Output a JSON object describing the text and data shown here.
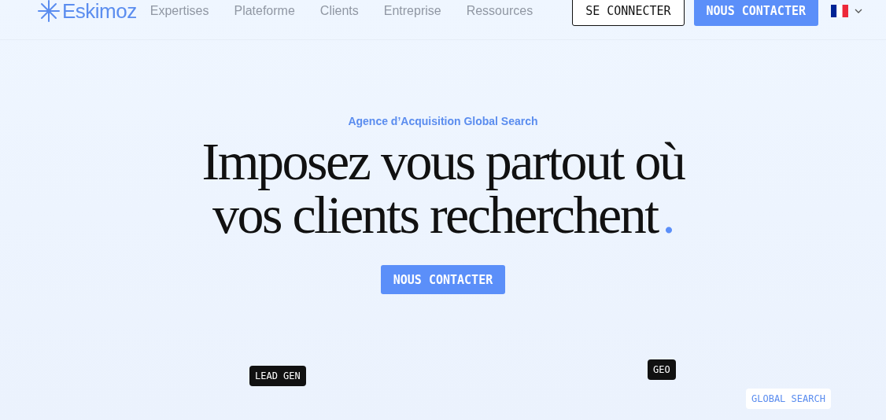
{
  "header": {
    "logo": "Eskimoz",
    "nav": [
      "Expertises",
      "Plateforme",
      "Clients",
      "Entreprise",
      "Ressources"
    ],
    "login_button": "SE CONNECTER",
    "contact_button": "NOUS CONTACTER"
  },
  "hero": {
    "eyebrow": "Agence d’Acquisition Global Search",
    "headline_lines": [
      "Imposez vous partout où",
      "vos clients recherchent"
    ],
    "headline_end": ".",
    "cta": "NOUS CONTACTER"
  },
  "tags": [
    {
      "label": "LEAD GEN",
      "kind": "dark"
    },
    {
      "label": "GEO",
      "kind": "dark"
    },
    {
      "label": "GLOBAL SEARCH",
      "kind": "light"
    }
  ]
}
